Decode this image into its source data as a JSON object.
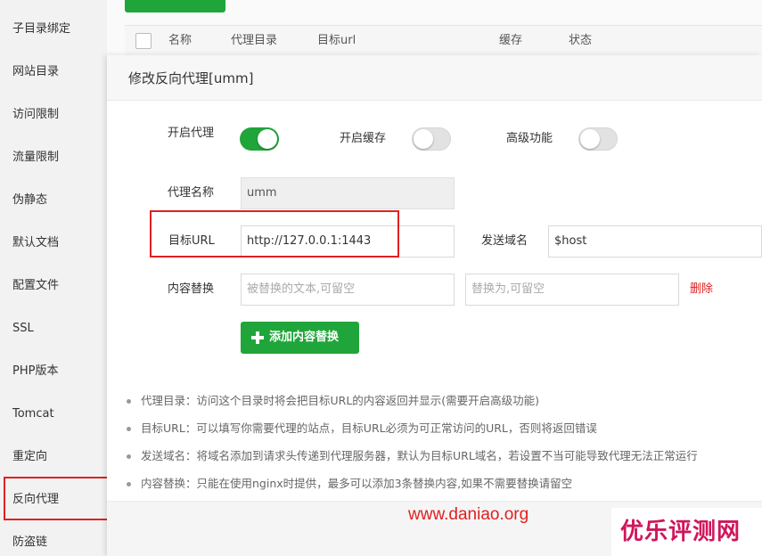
{
  "sidebar": {
    "items": [
      {
        "label": "子目录绑定"
      },
      {
        "label": "网站目录"
      },
      {
        "label": "访问限制"
      },
      {
        "label": "流量限制"
      },
      {
        "label": "伪静态"
      },
      {
        "label": "默认文档"
      },
      {
        "label": "配置文件"
      },
      {
        "label": "SSL"
      },
      {
        "label": "PHP版本"
      },
      {
        "label": "Tomcat"
      },
      {
        "label": "重定向"
      },
      {
        "label": "反向代理"
      },
      {
        "label": "防盗链"
      }
    ],
    "active_index": 11
  },
  "background_table": {
    "columns": [
      "名称",
      "代理目录",
      "目标url",
      "缓存",
      "状态"
    ]
  },
  "modal": {
    "title": "修改反向代理[umm]",
    "enable_proxy": {
      "label": "开启代理",
      "on": true
    },
    "enable_cache": {
      "label": "开启缓存",
      "on": false
    },
    "advanced": {
      "label": "高级功能",
      "on": false
    },
    "proxy_name": {
      "label": "代理名称",
      "value": "umm"
    },
    "target_url": {
      "label": "目标URL",
      "value": "http://127.0.0.1:1443"
    },
    "send_domain": {
      "label": "发送域名",
      "value": "$host"
    },
    "content_replace": {
      "label": "内容替换",
      "from_placeholder": "被替换的文本,可留空",
      "to_placeholder": "替换为,可留空",
      "delete_label": "删除"
    },
    "add_replace_button": "添加内容替换",
    "notes": [
      "代理目录：访问这个目录时将会把目标URL的内容返回并显示(需要开启高级功能)",
      "目标URL：可以填写你需要代理的站点，目标URL必须为可正常访问的URL，否则将返回错误",
      "发送域名：将域名添加到请求头传递到代理服务器，默认为目标URL域名，若设置不当可能导致代理无法正常运行",
      "内容替换：只能在使用nginx时提供，最多可以添加3条替换内容,如果不需要替换请留空"
    ]
  },
  "watermark": "www.daniao.org",
  "logo_text": "优乐评测网",
  "colors": {
    "accent_green": "#20a53a",
    "highlight_red": "#e02020",
    "logo_pink": "#d0155a"
  }
}
